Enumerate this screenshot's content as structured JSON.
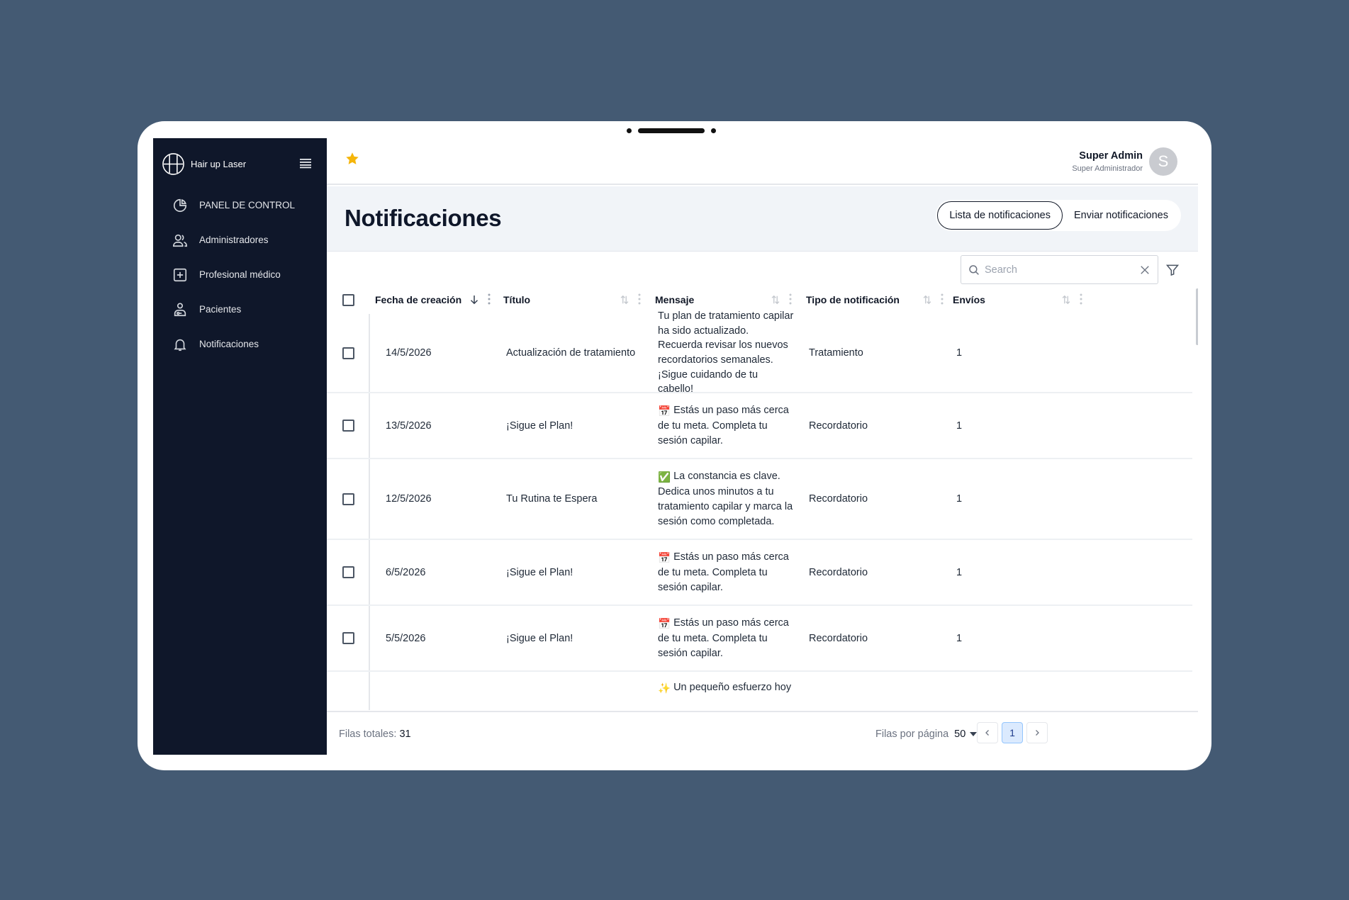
{
  "app": {
    "brand_name": "Hair up Laser"
  },
  "sidebar": {
    "items": [
      {
        "label": "PANEL DE CONTROL",
        "icon": "pie-chart-icon"
      },
      {
        "label": "Administradores",
        "icon": "users-icon"
      },
      {
        "label": "Profesional médico",
        "icon": "medical-plus-icon"
      },
      {
        "label": "Pacientes",
        "icon": "patient-icon"
      },
      {
        "label": "Notificaciones",
        "icon": "bell-icon"
      }
    ]
  },
  "header": {
    "user_name": "Super Admin",
    "user_role": "Super Administrador",
    "avatar_initial": "S"
  },
  "page": {
    "title": "Notificaciones",
    "tabs": [
      {
        "label": "Lista de notificaciones",
        "active": true
      },
      {
        "label": "Enviar notificaciones",
        "active": false
      }
    ]
  },
  "search": {
    "placeholder": "Search",
    "value": ""
  },
  "table": {
    "columns": [
      "Fecha de creación",
      "Título",
      "Mensaje",
      "Tipo de notificación",
      "Envíos"
    ],
    "rows": [
      {
        "fecha": "14/5/2026",
        "titulo": "Actualización de tratamiento",
        "emoji": "",
        "mensaje": "Tu plan de tratamiento capilar ha sido actualizado. Recuerda revisar los nuevos recordatorios semanales. ¡Sigue cuidando de tu cabello!",
        "tipo": "Tratamiento",
        "envios": "1"
      },
      {
        "fecha": "13/5/2026",
        "titulo": "¡Sigue el Plan!",
        "emoji": "📅",
        "mensaje": "Estás un paso más cerca de tu meta. Completa tu sesión capilar.",
        "tipo": "Recordatorio",
        "envios": "1"
      },
      {
        "fecha": "12/5/2026",
        "titulo": "Tu Rutina te Espera",
        "emoji": "✅",
        "mensaje": "La constancia es clave. Dedica unos minutos a tu tratamiento capilar y marca la sesión como completada.",
        "tipo": "Recordatorio",
        "envios": "1"
      },
      {
        "fecha": "6/5/2026",
        "titulo": "¡Sigue el Plan!",
        "emoji": "📅",
        "mensaje": "Estás un paso más cerca de tu meta. Completa tu sesión capilar.",
        "tipo": "Recordatorio",
        "envios": "1"
      },
      {
        "fecha": "5/5/2026",
        "titulo": "¡Sigue el Plan!",
        "emoji": "📅",
        "mensaje": "Estás un paso más cerca de tu meta. Completa tu sesión capilar.",
        "tipo": "Recordatorio",
        "envios": "1"
      }
    ],
    "partial_row_message": "Un pequeño esfuerzo hoy"
  },
  "footer": {
    "total_label": "Filas totales:",
    "total_value": "31",
    "per_page_label": "Filas por página",
    "per_page_value": "50",
    "current_page": "1"
  },
  "colors": {
    "background": "#445a73",
    "sidebar": "#0f172a",
    "star": "#f5b50a"
  }
}
